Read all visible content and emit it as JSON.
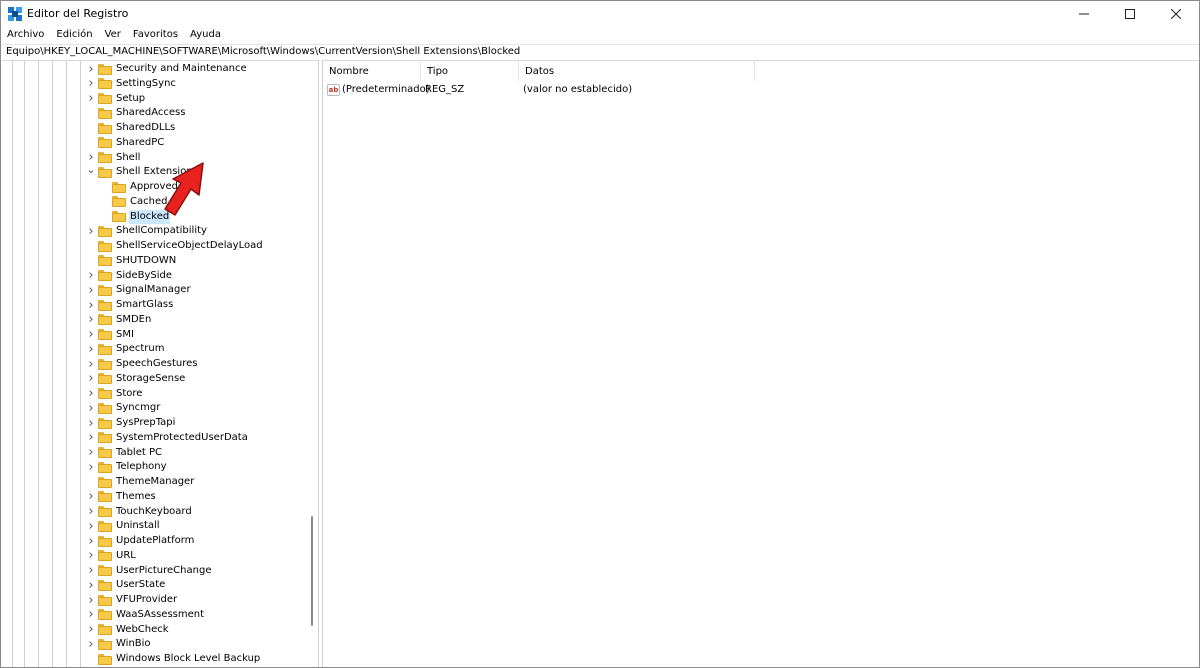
{
  "window": {
    "title": "Editor del Registro",
    "controls": {
      "minimize": "–",
      "maximize": "☐",
      "close": "✕"
    }
  },
  "menu": [
    "Archivo",
    "Edición",
    "Ver",
    "Favoritos",
    "Ayuda"
  ],
  "address": "Equipo\\HKEY_LOCAL_MACHINE\\SOFTWARE\\Microsoft\\Windows\\CurrentVersion\\Shell Extensions\\Blocked",
  "tree": {
    "items": [
      {
        "label": "Security and Maintenance",
        "level": 0,
        "expander": "collapsed"
      },
      {
        "label": "SettingSync",
        "level": 0,
        "expander": "collapsed"
      },
      {
        "label": "Setup",
        "level": 0,
        "expander": "collapsed"
      },
      {
        "label": "SharedAccess",
        "level": 0,
        "expander": "none"
      },
      {
        "label": "SharedDLLs",
        "level": 0,
        "expander": "none"
      },
      {
        "label": "SharedPC",
        "level": 0,
        "expander": "none"
      },
      {
        "label": "Shell",
        "level": 0,
        "expander": "collapsed"
      },
      {
        "label": "Shell Extensions",
        "level": 0,
        "expander": "expanded"
      },
      {
        "label": "Approved",
        "level": 1,
        "expander": "none"
      },
      {
        "label": "Cached",
        "level": 1,
        "expander": "none"
      },
      {
        "label": "Blocked",
        "level": 1,
        "expander": "none",
        "selected": true
      },
      {
        "label": "ShellCompatibility",
        "level": 0,
        "expander": "collapsed"
      },
      {
        "label": "ShellServiceObjectDelayLoad",
        "level": 0,
        "expander": "none"
      },
      {
        "label": "SHUTDOWN",
        "level": 0,
        "expander": "none"
      },
      {
        "label": "SideBySide",
        "level": 0,
        "expander": "collapsed"
      },
      {
        "label": "SignalManager",
        "level": 0,
        "expander": "collapsed"
      },
      {
        "label": "SmartGlass",
        "level": 0,
        "expander": "collapsed"
      },
      {
        "label": "SMDEn",
        "level": 0,
        "expander": "collapsed"
      },
      {
        "label": "SMI",
        "level": 0,
        "expander": "collapsed"
      },
      {
        "label": "Spectrum",
        "level": 0,
        "expander": "collapsed"
      },
      {
        "label": "SpeechGestures",
        "level": 0,
        "expander": "collapsed"
      },
      {
        "label": "StorageSense",
        "level": 0,
        "expander": "collapsed"
      },
      {
        "label": "Store",
        "level": 0,
        "expander": "collapsed"
      },
      {
        "label": "Syncmgr",
        "level": 0,
        "expander": "collapsed"
      },
      {
        "label": "SysPrepTapi",
        "level": 0,
        "expander": "collapsed"
      },
      {
        "label": "SystemProtectedUserData",
        "level": 0,
        "expander": "collapsed"
      },
      {
        "label": "Tablet PC",
        "level": 0,
        "expander": "collapsed"
      },
      {
        "label": "Telephony",
        "level": 0,
        "expander": "collapsed"
      },
      {
        "label": "ThemeManager",
        "level": 0,
        "expander": "none"
      },
      {
        "label": "Themes",
        "level": 0,
        "expander": "collapsed"
      },
      {
        "label": "TouchKeyboard",
        "level": 0,
        "expander": "collapsed"
      },
      {
        "label": "Uninstall",
        "level": 0,
        "expander": "collapsed"
      },
      {
        "label": "UpdatePlatform",
        "level": 0,
        "expander": "collapsed"
      },
      {
        "label": "URL",
        "level": 0,
        "expander": "collapsed"
      },
      {
        "label": "UserPictureChange",
        "level": 0,
        "expander": "collapsed"
      },
      {
        "label": "UserState",
        "level": 0,
        "expander": "collapsed"
      },
      {
        "label": "VFUProvider",
        "level": 0,
        "expander": "collapsed"
      },
      {
        "label": "WaaSAssessment",
        "level": 0,
        "expander": "collapsed"
      },
      {
        "label": "WebCheck",
        "level": 0,
        "expander": "collapsed"
      },
      {
        "label": "WinBio",
        "level": 0,
        "expander": "collapsed"
      },
      {
        "label": "Windows Block Level Backup",
        "level": 0,
        "expander": "none"
      }
    ]
  },
  "list": {
    "columns": {
      "name": "Nombre",
      "type": "Tipo",
      "data": "Datos"
    },
    "rows": [
      {
        "icon": "ab",
        "name": "(Predeterminado)",
        "type": "REG_SZ",
        "data": "(valor no establecido)"
      }
    ]
  },
  "colors": {
    "selection": "#cce8ff",
    "folder": "#f7c948",
    "annotation_arrow": "#e8231f"
  },
  "icons": {
    "app": "registry-editor-icon",
    "folder": "folder-icon",
    "value": "string-value-icon",
    "annotation": "red-arrow-icon"
  }
}
